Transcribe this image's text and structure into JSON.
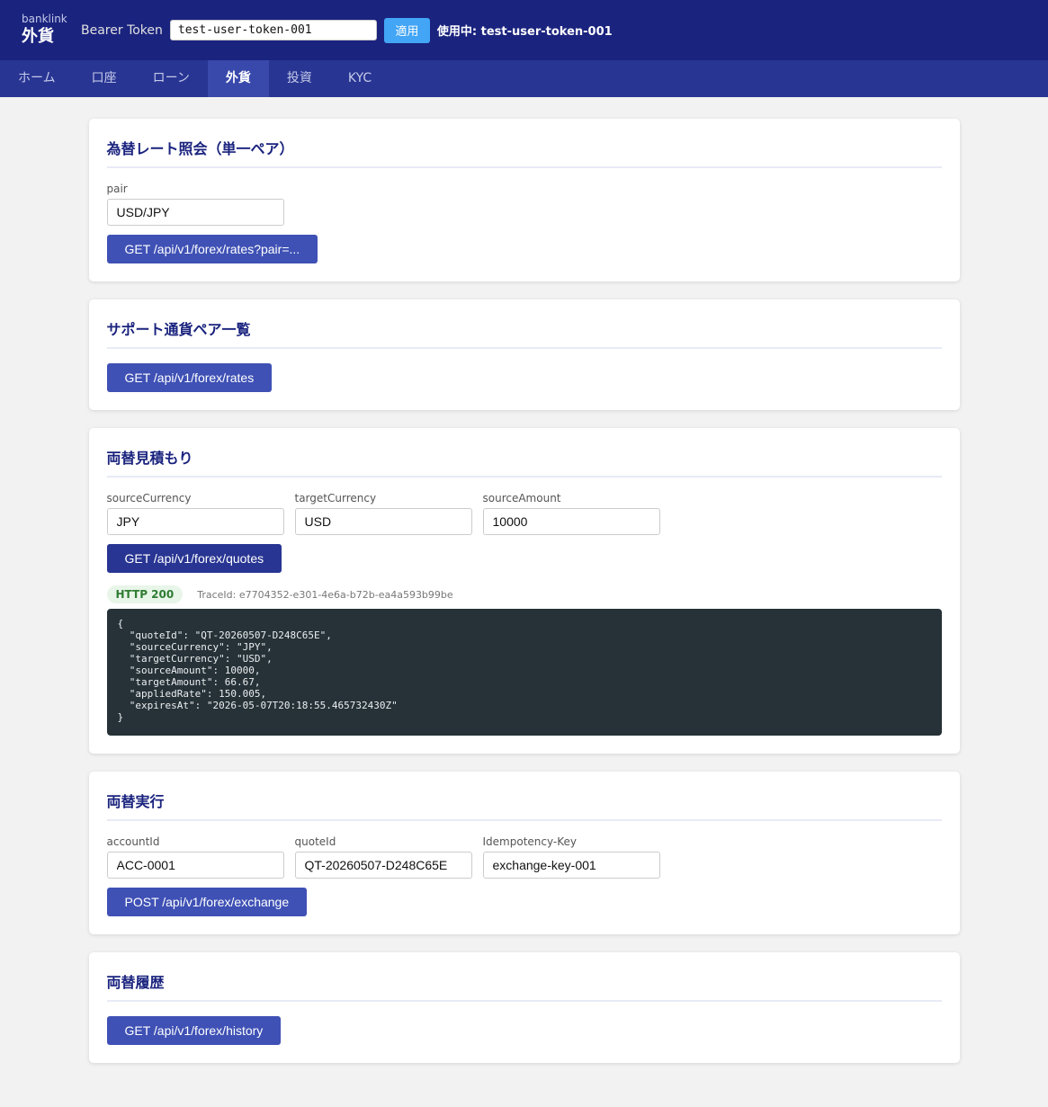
{
  "header": {
    "brand_sub": "banklink",
    "brand_title": "外貨",
    "token_label": "Bearer Token",
    "token_value": "test-user-token-001",
    "apply_label": "適用",
    "status_text": "使用中: test-user-token-001"
  },
  "tabs": [
    {
      "label": "ホーム",
      "active": false
    },
    {
      "label": "口座",
      "active": false
    },
    {
      "label": "ローン",
      "active": false
    },
    {
      "label": "外貨",
      "active": true
    },
    {
      "label": "投資",
      "active": false
    },
    {
      "label": "KYC",
      "active": false
    }
  ],
  "sections": {
    "rate": {
      "title": "為替レート照会（単一ペア）",
      "pair_label": "pair",
      "pair_value": "USD/JPY",
      "button": "GET /api/v1/forex/rates?pair=..."
    },
    "pairs": {
      "title": "サポート通貨ペア一覧",
      "button": "GET /api/v1/forex/rates"
    },
    "quote": {
      "title": "両替見積もり",
      "source_currency_label": "sourceCurrency",
      "source_currency_value": "JPY",
      "target_currency_label": "targetCurrency",
      "target_currency_value": "USD",
      "source_amount_label": "sourceAmount",
      "source_amount_value": "10000",
      "button": "GET /api/v1/forex/quotes",
      "status": "HTTP 200",
      "trace": "TraceId: e7704352-e301-4e6a-b72b-ea4a593b99be",
      "response": "{\n  \"quoteId\": \"QT-20260507-D248C65E\",\n  \"sourceCurrency\": \"JPY\",\n  \"targetCurrency\": \"USD\",\n  \"sourceAmount\": 10000,\n  \"targetAmount\": 66.67,\n  \"appliedRate\": 150.005,\n  \"expiresAt\": \"2026-05-07T20:18:55.465732430Z\"\n}"
    },
    "exchange": {
      "title": "両替実行",
      "account_label": "accountId",
      "account_value": "ACC-0001",
      "quote_label": "quoteId",
      "quote_value": "QT-20260507-D248C65E",
      "idem_label": "Idempotency-Key",
      "idem_value": "exchange-key-001",
      "button": "POST /api/v1/forex/exchange"
    },
    "history": {
      "title": "両替履歴",
      "button": "GET /api/v1/forex/history"
    }
  },
  "colors": {
    "topbar": "#1a237e",
    "tabbar": "#283593",
    "tab_active": "#3949ab",
    "button": "#3f51b5",
    "apply": "#42a5f5",
    "response_bg": "#263238"
  }
}
